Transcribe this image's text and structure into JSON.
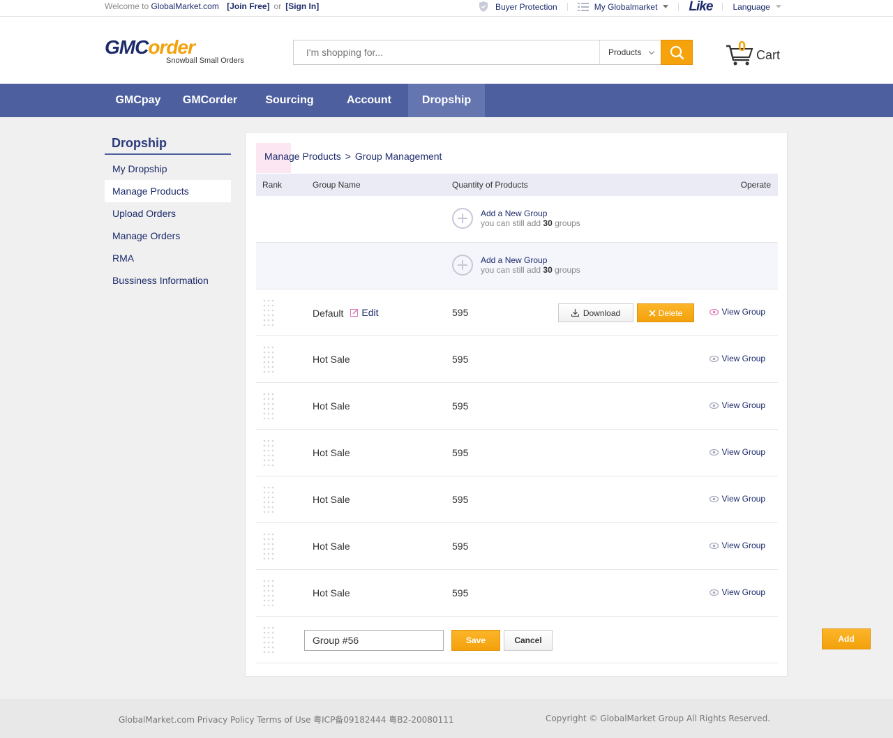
{
  "topbar": {
    "welcome": "Welcome to",
    "site": "GlobalMarket.com",
    "join": "[Join Free]",
    "or": "or",
    "signin": "[Sign In]",
    "buyer_protection": "Buyer Protection",
    "my_globalmarket": "My Globalmarket",
    "like": "Like",
    "language": "Language"
  },
  "header": {
    "logo_gmc": "GMC",
    "logo_order": "order",
    "logo_tagline": "Snowball Small Orders",
    "search_placeholder": "I'm shopping for...",
    "search_category": "Products",
    "cart_count": "0",
    "cart_label": "Cart"
  },
  "nav": [
    {
      "label": "GMCpay"
    },
    {
      "label": "GMCorder"
    },
    {
      "label": "Sourcing"
    },
    {
      "label": "Account"
    },
    {
      "label": "Dropship"
    }
  ],
  "sidebar": {
    "title": "Dropship",
    "items": [
      {
        "label": "My Dropship"
      },
      {
        "label": "Manage Products"
      },
      {
        "label": "Upload Orders"
      },
      {
        "label": "Manage Orders"
      },
      {
        "label": "RMA"
      },
      {
        "label": "Bussiness Information"
      }
    ]
  },
  "breadcrumb": {
    "first": "Manage Products",
    "sep": ">",
    "current": "Group Management"
  },
  "table": {
    "headers": {
      "rank": "Rank",
      "name": "Group Name",
      "qty": "Quantity of Products",
      "operate": "Operate"
    },
    "add_group": {
      "title": "Add a New Group",
      "hint_pre": "you can still add",
      "hint_num": "30",
      "hint_post": "groups"
    },
    "edit_label": "Edit",
    "download_label": "Download",
    "delete_label": "Delete",
    "view_label": "View Group",
    "rows": [
      {
        "name": "Default",
        "qty": "595"
      },
      {
        "name": "Hot Sale",
        "qty": "595"
      },
      {
        "name": "Hot Sale",
        "qty": "595"
      },
      {
        "name": "Hot Sale",
        "qty": "595"
      },
      {
        "name": "Hot Sale",
        "qty": "595"
      },
      {
        "name": "Hot Sale",
        "qty": "595"
      },
      {
        "name": "Hot Sale",
        "qty": "595"
      }
    ],
    "new_group_value": "Group #56",
    "save_label": "Save",
    "cancel_label": "Cancel"
  },
  "add_button": "Add",
  "footer": {
    "left": "GlobalMarket.com Privacy Policy Terms of Use 粤ICP备09182444 粤B2-20080111",
    "right": "Copyright © GlobalMarket Group All Rights Reserved."
  },
  "colors": {
    "brand_navy": "#1d2b6b",
    "accent_orange": "#f5a20b",
    "nav_bg": "#4d5f9e"
  }
}
